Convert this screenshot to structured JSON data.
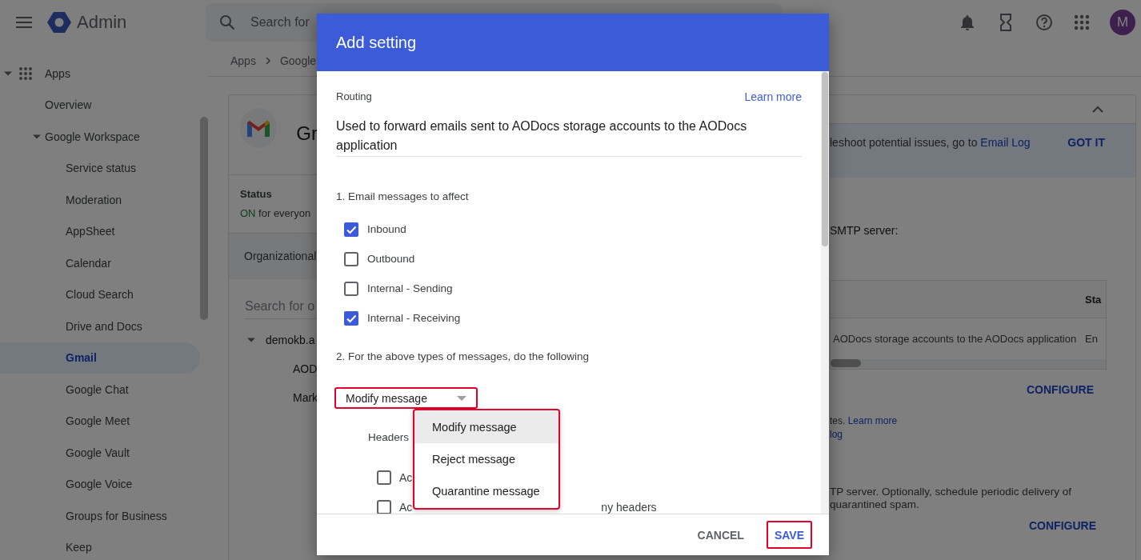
{
  "top_bar": {
    "app_name": "Admin",
    "search": {
      "placeholder": "Search for"
    },
    "avatar": "M"
  },
  "sidebar": {
    "items": [
      {
        "label": "Apps",
        "expanded": true,
        "selected": false,
        "children": [
          {
            "label": "Overview",
            "selected": false
          },
          {
            "label": "Google Workspace",
            "expanded": true,
            "selected": false,
            "children": [
              {
                "label": "Service status",
                "selected": false
              },
              {
                "label": "Moderation",
                "selected": false
              },
              {
                "label": "AppSheet",
                "selected": false
              },
              {
                "label": "Calendar",
                "selected": false
              },
              {
                "label": "Cloud Search",
                "selected": false
              },
              {
                "label": "Drive and Docs",
                "selected": false
              },
              {
                "label": "Gmail",
                "selected": true
              },
              {
                "label": "Google Chat",
                "selected": false
              },
              {
                "label": "Google Meet",
                "selected": false
              },
              {
                "label": "Google Vault",
                "selected": false
              },
              {
                "label": "Google Voice",
                "selected": false
              },
              {
                "label": "Groups for Business",
                "selected": false
              },
              {
                "label": "Keep",
                "selected": false
              }
            ]
          }
        ]
      }
    ]
  },
  "breadcrumb": [
    "Apps",
    "Google"
  ],
  "card": {
    "title": "Gr",
    "status_label": "Status",
    "status_value": "ON",
    "status_scope": "for everyon",
    "org_heading": "Organizational",
    "org_search": {
      "placeholder": "Search for o"
    },
    "org_tree": [
      {
        "label": "demokb.a",
        "expanded": true,
        "children": [
          {
            "label": "AOD"
          },
          {
            "label": "Mark"
          }
        ]
      }
    ],
    "panel": {
      "expanded": true,
      "banner": {
        "text": "leshoot potential issues, go to",
        "link": "Email Log",
        "action": "GOT IT"
      },
      "smtp_label": "SMTP server:",
      "table": {
        "columns": [
          "",
          "Sta"
        ],
        "rows": [
          {
            "cells": [
              "AODocs storage accounts to the AODocs application",
              "En"
            ]
          }
        ]
      },
      "routing_action": "CONFIGURE",
      "note": {
        "text": "tes.",
        "link": "Learn more",
        "link_2": "log"
      },
      "quarantine_text": "TP server. Optionally, schedule periodic delivery of quarantined spam.",
      "quarantine_action": "CONFIGURE"
    }
  },
  "dialog": {
    "title": "Add setting",
    "section_label": "Routing",
    "learn_more": "Learn more",
    "description": "Used to forward emails sent to AODocs storage accounts to the AODocs application",
    "step_1": "1. Email messages to affect",
    "message_types": [
      {
        "label": "Inbound",
        "checked": true
      },
      {
        "label": "Outbound",
        "checked": false
      },
      {
        "label": "Internal - Sending",
        "checked": false
      },
      {
        "label": "Internal - Receiving",
        "checked": true
      }
    ],
    "step_2": "2. For the above types of messages, do the following",
    "action_select": {
      "value": "Modify message",
      "highlighted": true,
      "open": true
    },
    "action_menu": {
      "highlighted": true,
      "options": [
        {
          "label": "Modify message",
          "selected": true
        },
        {
          "label": "Reject message",
          "selected": false
        },
        {
          "label": "Quarantine message",
          "selected": false
        }
      ]
    },
    "headers_label": "Headers",
    "header_options": [
      {
        "checked": false,
        "label_parts": [
          "Ac"
        ]
      },
      {
        "checked": false,
        "label_parts": [
          "Ac",
          "ny headers"
        ]
      }
    ],
    "buttons": [
      {
        "label": "CANCEL",
        "kind": "secondary",
        "highlighted": false
      },
      {
        "label": "SAVE",
        "kind": "primary",
        "highlighted": true
      }
    ]
  }
}
